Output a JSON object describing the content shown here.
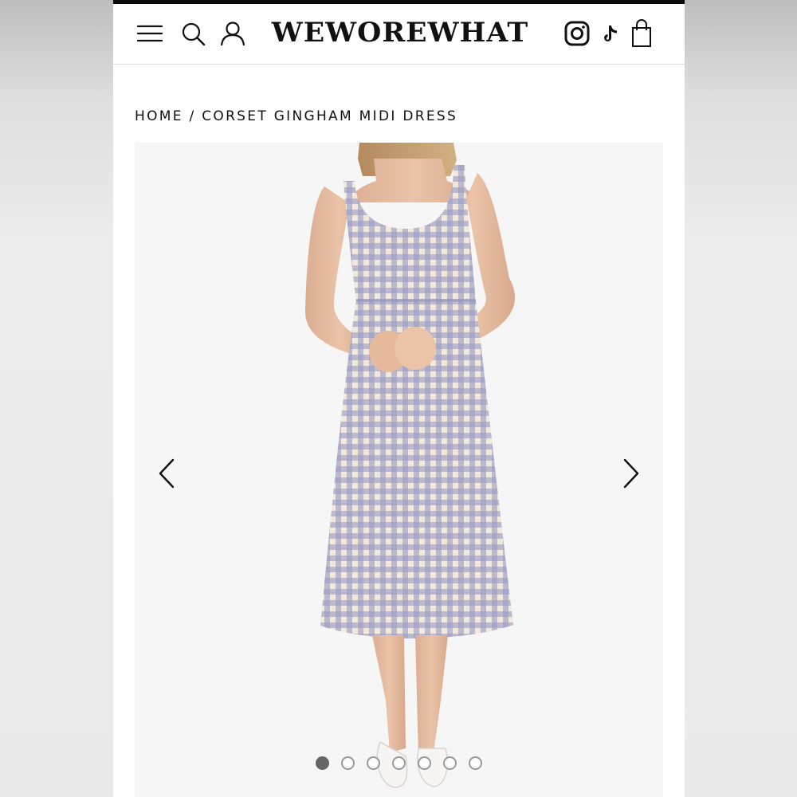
{
  "header": {
    "logo": "WEWOREWHAT",
    "icons": [
      "menu-icon",
      "search-icon",
      "account-icon",
      "instagram-icon",
      "tiktok-icon",
      "shopping-bag-icon"
    ]
  },
  "breadcrumb": {
    "home": "HOME",
    "separator": " / ",
    "current": "CORSET GINGHAM MIDI DRESS"
  },
  "gallery": {
    "image_description": "Model wearing a blue and cream gingham sleeveless midi dress with white pointed flats",
    "dress_color": "#8e92b8",
    "base_color": "#f1e8df",
    "slide_count": 7,
    "active_slide": 1
  },
  "colors": {
    "accent": "#111111",
    "top_bar": "#0a0a0a",
    "dot_active": "#666666"
  }
}
